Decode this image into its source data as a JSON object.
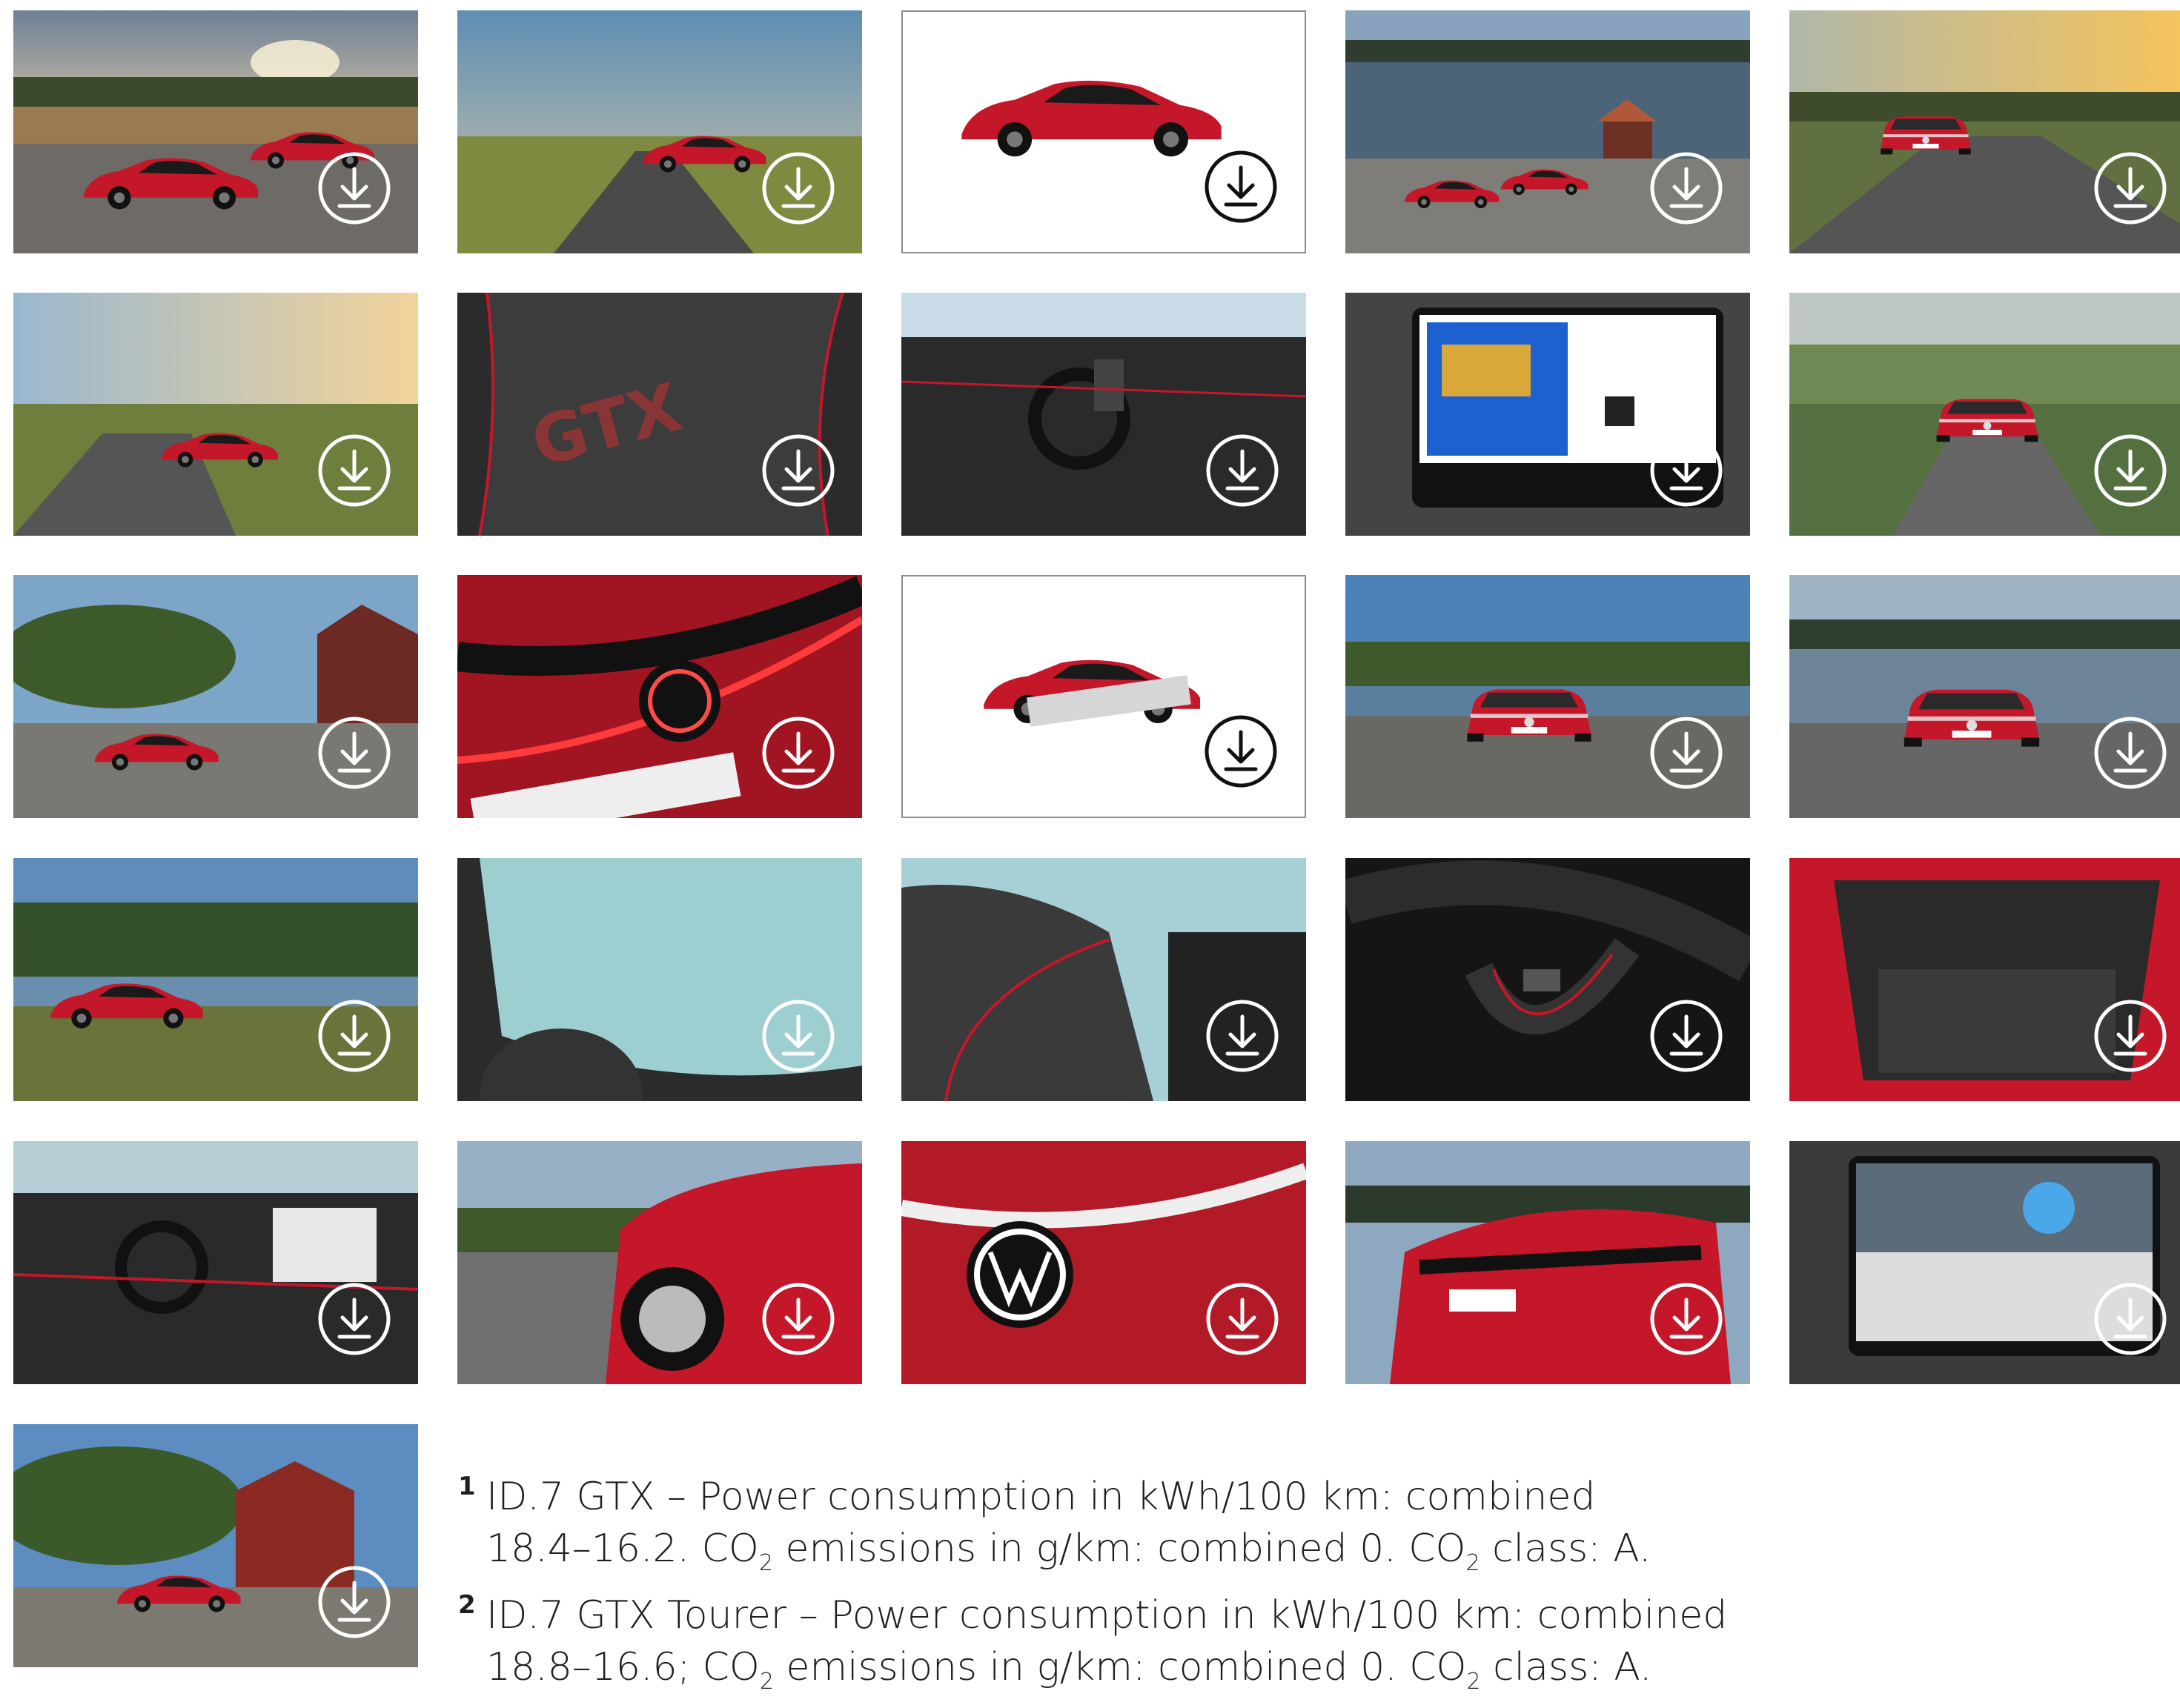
{
  "gallery": {
    "download_label": "Download",
    "tiles": [
      {
        "subject": "two red cars on gravel at sunset field",
        "style": "photo-sunset"
      },
      {
        "subject": "red sedan driving country road",
        "style": "photo-road"
      },
      {
        "subject": "red estate car studio side view",
        "style": "studio-car"
      },
      {
        "subject": "two red cars by lake with boathouse",
        "style": "photo-lake"
      },
      {
        "subject": "red car on road at golden hour",
        "style": "photo-golden"
      },
      {
        "subject": "red estate on road at sunset",
        "style": "photo-road2"
      },
      {
        "subject": "seat with GTX embroidery",
        "style": "seat-gtx"
      },
      {
        "subject": "cockpit interior",
        "style": "interior"
      },
      {
        "subject": "infotainment screen with game",
        "style": "screen-game"
      },
      {
        "subject": "red car front on foggy road",
        "style": "photo-fog"
      },
      {
        "subject": "red sedan by red barn",
        "style": "photo-barn"
      },
      {
        "subject": "illuminated logo light bar close-up",
        "style": "lightbar"
      },
      {
        "subject": "cutaway chassis studio",
        "style": "studio-chassis"
      },
      {
        "subject": "red car front by lake",
        "style": "photo-front"
      },
      {
        "subject": "red estate rear view by lake",
        "style": "photo-rear"
      },
      {
        "subject": "red car side by lake with stones",
        "style": "photo-side"
      },
      {
        "subject": "panoramic glass roof",
        "style": "roof"
      },
      {
        "subject": "sport seat with red piping",
        "style": "seat2"
      },
      {
        "subject": "steering wheel GTX badge",
        "style": "wheel"
      },
      {
        "subject": "open boot of estate",
        "style": "boot"
      },
      {
        "subject": "dashboard interior view",
        "style": "dash"
      },
      {
        "subject": "front wheel detail by lake",
        "style": "wheel-detail"
      },
      {
        "subject": "front logo close-up",
        "style": "logo"
      },
      {
        "subject": "rear light bar detail",
        "style": "rear-detail"
      },
      {
        "subject": "infotainment screen menu",
        "style": "screen-menu"
      },
      {
        "subject": "red estate by red houses",
        "style": "photo-houses"
      }
    ]
  },
  "footnotes": [
    {
      "num": "1",
      "line1": "ID.7 GTX – Power consumption in kWh/100 km: combined",
      "line2a": "18.4–16.2. CO",
      "line2b": " emissions in g/km: combined 0. CO",
      "line2c": " class: A."
    },
    {
      "num": "2",
      "line1": "ID.7 GTX Tourer – Power consumption in kWh/100 km: combined",
      "line2a": "18.8–16.6; CO",
      "line2b": " emissions in g/km: combined 0. CO",
      "line2c": " class: A."
    }
  ],
  "sub2": "2",
  "colors": {
    "car_red": "#c4172a",
    "sky_blue": "#7fa6c8",
    "grass": "#5e7f35",
    "road": "#4a4a4a",
    "icon": "#ffffff",
    "icon_dark": "#111111"
  }
}
